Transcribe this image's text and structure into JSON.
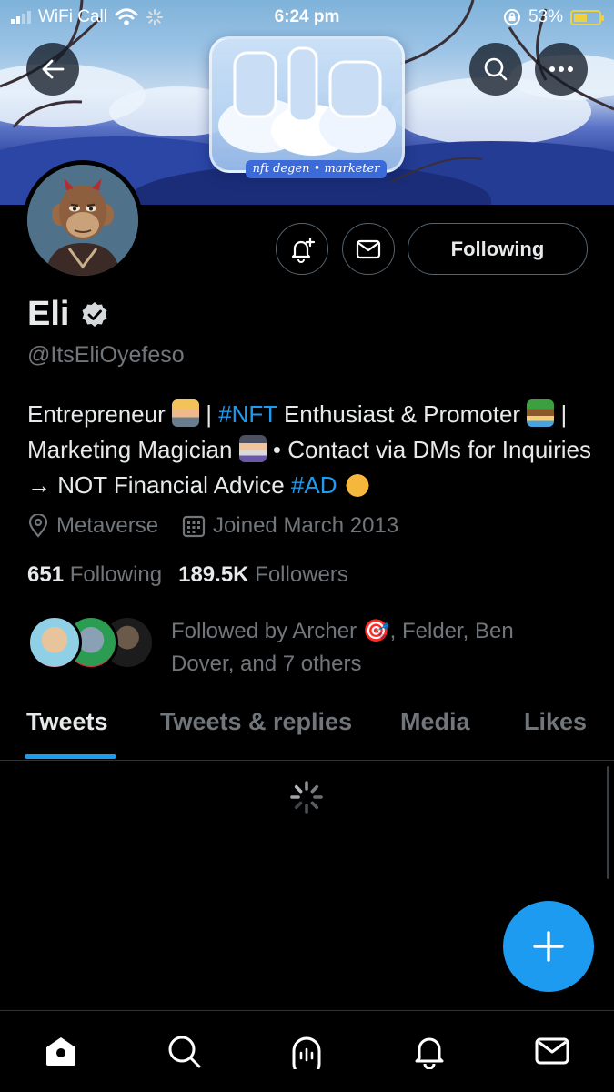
{
  "status_bar": {
    "carrier": "WiFi Call",
    "time": "6:24 pm",
    "battery_percent": "53%",
    "battery_level": 0.53
  },
  "banner": {
    "tagline": "nft degen • marketer"
  },
  "profile": {
    "name": "Eli",
    "handle": "@ItsEliOyefeso",
    "follow_button_label": "Following",
    "bio": {
      "part1": "Entrepreneur ",
      "part2": " | ",
      "hashtag1": "#NFT",
      "part3": " Enthusiast & Promoter ",
      "part4": " | Marketing Magician ",
      "part5": " • Contact via DMs for Inquiries → NOT Financial Advice ",
      "hashtag2": "#AD"
    },
    "location": "Metaverse",
    "joined": "Joined March 2013",
    "following_count": "651",
    "following_label": "Following",
    "followers_count": "189.5K",
    "followers_label": "Followers",
    "followed_by_text": "Followed by Archer 🎯, Felder, Ben Dover, and 7 others"
  },
  "tabs": [
    {
      "label": "Tweets",
      "active": true
    },
    {
      "label": "Tweets & replies",
      "active": false
    },
    {
      "label": "Media",
      "active": false
    },
    {
      "label": "Likes",
      "active": false
    }
  ],
  "bottom_nav": [
    "home-icon",
    "search-icon",
    "spaces-icon",
    "notifications-icon",
    "messages-icon"
  ],
  "colors": {
    "accent": "#1d9bf0",
    "background": "#000000",
    "secondary_text": "#71767b",
    "battery": "#f0d043"
  }
}
